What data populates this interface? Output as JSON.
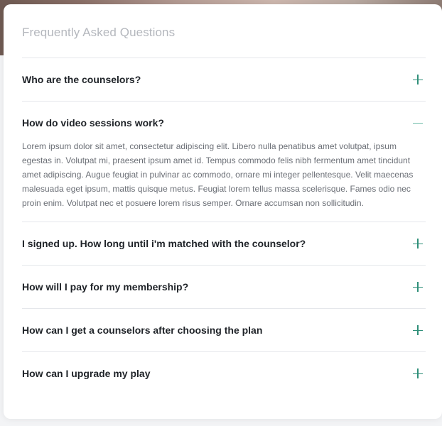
{
  "faq": {
    "title": "Frequently Asked Questions",
    "items": [
      {
        "question": "Who are the counselors?",
        "expanded": false,
        "icon": "plus-icon",
        "answer": ""
      },
      {
        "question": "How do video sessions work?",
        "expanded": true,
        "icon": "minus-icon",
        "answer": "Lorem ipsum dolor sit amet, consectetur adipiscing elit. Libero nulla penatibus amet volutpat, ipsum egestas in. Volutpat mi, praesent ipsum amet id. Tempus commodo felis nibh fermentum amet tincidunt amet adipiscing. Augue feugiat in pulvinar ac commodo, ornare mi integer pellentesque. Velit maecenas malesuada eget ipsum, mattis quisque metus. Feugiat lorem tellus massa scelerisque. Fames odio nec proin enim. Volutpat nec et posuere lorem risus semper. Ornare accumsan non sollicitudin."
      },
      {
        "question": "I signed up. How long until i'm matched with the counselor?",
        "expanded": false,
        "icon": "plus-icon",
        "answer": ""
      },
      {
        "question": "How will I pay for my membership?",
        "expanded": false,
        "icon": "plus-icon",
        "answer": ""
      },
      {
        "question": "How can I get a counselors after choosing the plan",
        "expanded": false,
        "icon": "plus-icon",
        "answer": ""
      },
      {
        "question": "How can I upgrade my play",
        "expanded": false,
        "icon": "plus-icon",
        "answer": ""
      }
    ]
  },
  "colors": {
    "accent": "#2f8f79",
    "title": "#b4b7bd",
    "question": "#1f2328",
    "answer": "#6b6f76",
    "divider": "#e5e7eb"
  }
}
